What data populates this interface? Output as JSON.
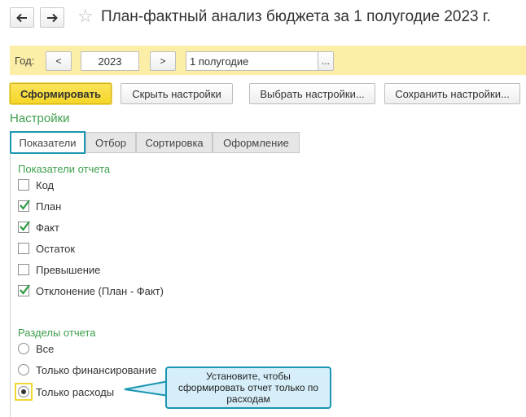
{
  "header": {
    "title": "План-фактный анализ бюджета за 1 полугодие 2023 г.",
    "back_icon": "arrow-left-icon",
    "forward_icon": "arrow-right-icon",
    "favorite_icon": "star-icon"
  },
  "period": {
    "label": "Год:",
    "prev_label": "<",
    "year_value": "2023",
    "next_label": ">",
    "period_value": "1 полугодие",
    "choose_label": "..."
  },
  "toolbar": {
    "generate": "Сформировать",
    "hide_settings": "Скрыть настройки",
    "select_settings": "Выбрать настройки...",
    "save_settings": "Сохранить настройки..."
  },
  "settings": {
    "title": "Настройки",
    "tabs": [
      {
        "label": "Показатели",
        "active": true
      },
      {
        "label": "Отбор",
        "active": false
      },
      {
        "label": "Сортировка",
        "active": false
      },
      {
        "label": "Оформление",
        "active": false
      }
    ],
    "indicators": {
      "title": "Показатели отчета",
      "items": [
        {
          "label": "Код",
          "checked": false
        },
        {
          "label": "План",
          "checked": true
        },
        {
          "label": "Факт",
          "checked": true
        },
        {
          "label": "Остаток",
          "checked": false
        },
        {
          "label": "Превышение",
          "checked": false
        },
        {
          "label": "Отклонение (План - Факт)",
          "checked": true
        }
      ]
    },
    "sections": {
      "title": "Разделы отчета",
      "options": [
        {
          "label": "Все",
          "selected": false
        },
        {
          "label": "Только финансирование",
          "selected": false
        },
        {
          "label": "Только расходы",
          "selected": true
        }
      ]
    }
  },
  "tooltip": {
    "text": "Установите, чтобы сформировать отчет только по расходам"
  },
  "colors": {
    "accent_green": "#3d9f4b",
    "highlight_yellow": "#fdeea7",
    "primary_button": "#f5d628",
    "tab_focus": "#1a96b0",
    "callout_bg": "#d6eef9"
  }
}
